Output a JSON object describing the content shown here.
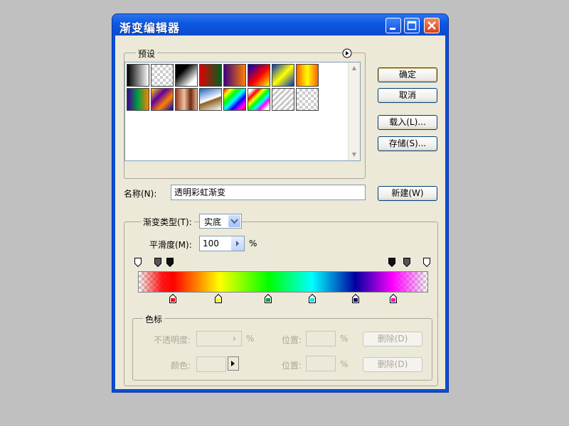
{
  "window": {
    "title": "渐变编辑器"
  },
  "presets": {
    "label": "预设",
    "swatches_row1": [
      "black-white",
      "transparent-checker",
      "black-white-reverse",
      "red-green",
      "violet-orange",
      "blue-red-yellow",
      "blue-yellow-blue",
      "orange-yellow-orange"
    ],
    "swatches_row2": [
      "violet-green-orange",
      "yellow-violet-orange-blue",
      "copper",
      "chrome",
      "spectrum",
      "transparent-rainbow",
      "transparent-stripes",
      "neutral-checker"
    ]
  },
  "buttons": {
    "ok": "确定",
    "cancel": "取消",
    "load": "载入(L)...",
    "save": "存储(S)...",
    "new": "新建(W)"
  },
  "name": {
    "label": "名称(N):",
    "value": "透明彩虹渐变"
  },
  "gradient": {
    "type_label": "渐变类型(T):",
    "type_value": "实底",
    "smoothness_label": "平滑度(M):",
    "smoothness_value": "100",
    "smoothness_unit": "%",
    "opacity_stops": [
      {
        "position": 0,
        "opacity": 0
      },
      {
        "position": 7,
        "opacity": 100
      },
      {
        "position": 11,
        "opacity": 100
      },
      {
        "position": 88,
        "opacity": 100
      },
      {
        "position": 93,
        "opacity": 100
      },
      {
        "position": 100,
        "opacity": 0
      }
    ],
    "color_stops": [
      {
        "position": 12,
        "color": "#ff0000"
      },
      {
        "position": 28,
        "color": "#ffff00"
      },
      {
        "position": 45,
        "color": "#00ff00"
      },
      {
        "position": 60,
        "color": "#00ffff"
      },
      {
        "position": 75,
        "color": "#0000a0"
      },
      {
        "position": 88,
        "color": "#ff00ff"
      }
    ]
  },
  "color_stops_group": {
    "label": "色标",
    "opacity_label": "不透明度:",
    "percent": "%",
    "location_label": "位置:",
    "delete_label": "删除(D)",
    "color_label": "颜色:"
  }
}
